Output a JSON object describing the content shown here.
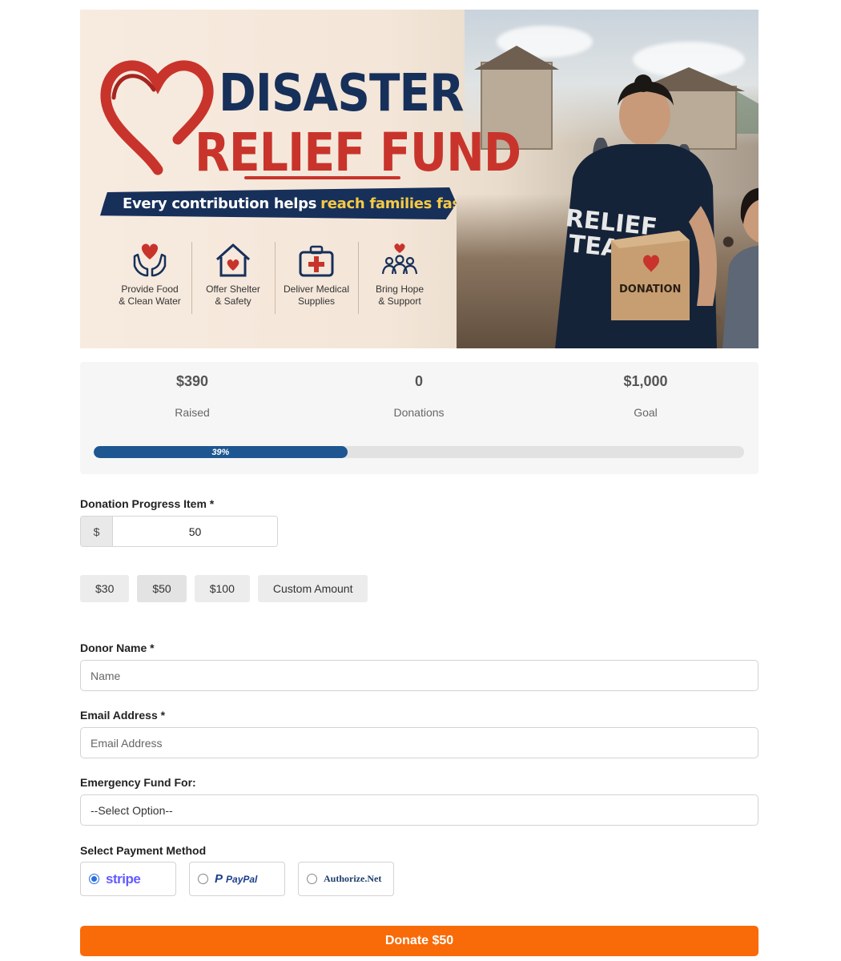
{
  "banner": {
    "title_line1": "DISASTER",
    "title_line2": "RELIEF FUND",
    "tagline_main": "Every contribution helps",
    "tagline_highlight": "reach families faster.",
    "shirt_text_line1": "RELIEF",
    "shirt_text_line2": "TEAM",
    "box_label": "DONATION",
    "features": [
      {
        "icon": "hands-heart-icon",
        "line1": "Provide Food",
        "line2": "& Clean Water"
      },
      {
        "icon": "house-heart-icon",
        "line1": "Offer Shelter",
        "line2": "& Safety"
      },
      {
        "icon": "medical-kit-icon",
        "line1": "Deliver Medical",
        "line2": "Supplies"
      },
      {
        "icon": "people-heart-icon",
        "line1": "Bring Hope",
        "line2": "& Support"
      }
    ],
    "colors": {
      "navy": "#17305a",
      "red": "#c8342b",
      "yellow": "#f6c945"
    }
  },
  "stats": {
    "raised_value": "$390",
    "raised_label": "Raised",
    "donations_value": "0",
    "donations_label": "Donations",
    "goal_value": "$1,000",
    "goal_label": "Goal",
    "progress_text": "39%",
    "progress_fraction": 0.39,
    "progress_color": "#1d5691"
  },
  "form": {
    "amount_label": "Donation Progress Item *",
    "currency_symbol": "$",
    "amount_value": "50",
    "presets": [
      "$30",
      "$50",
      "$100",
      "Custom Amount"
    ],
    "donor_name_label": "Donor Name *",
    "donor_name_placeholder": "Name",
    "email_label": "Email Address *",
    "email_placeholder": "Email Address",
    "fund_label": "Emergency Fund For:",
    "fund_selected": "--Select Option--",
    "payment_label": "Select Payment Method",
    "payment_methods": [
      {
        "name": "stripe",
        "selected": true
      },
      {
        "name": "PayPal",
        "selected": false
      },
      {
        "name": "Authorize.Net",
        "selected": false
      }
    ],
    "donate_button": "Donate $50",
    "donate_color": "#f96b08"
  }
}
